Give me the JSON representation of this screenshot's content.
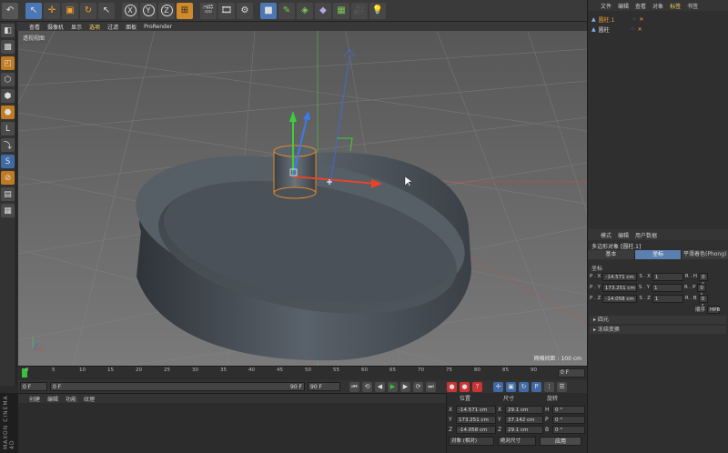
{
  "toolbar": {
    "icons": [
      "undo-icon",
      "select-icon",
      "move-icon",
      "scale-icon",
      "rotate-icon",
      "live-select-icon",
      "x-axis-icon",
      "y-axis-icon",
      "z-axis-icon",
      "world-coords-icon",
      "render-view-icon",
      "render-picture-icon",
      "render-settings-icon",
      "cube-icon",
      "pen-icon",
      "subdivision-icon",
      "deformer-icon",
      "environment-icon",
      "camera-icon",
      "light-icon"
    ],
    "axes": [
      "X",
      "Y",
      "Z"
    ]
  },
  "viewport": {
    "menu": [
      "查看",
      "摄像机",
      "显示",
      "选项",
      "过滤",
      "面板",
      "ProRender"
    ],
    "active_menu": "选项",
    "label": "透视视图",
    "grid_scale": "网格间距 : 100 cm"
  },
  "timeline": {
    "ticks": [
      "0",
      "5",
      "10",
      "15",
      "20",
      "25",
      "30",
      "35",
      "40",
      "45",
      "50",
      "55",
      "60",
      "65",
      "70",
      "75",
      "80",
      "85",
      "90"
    ],
    "frame_end": "0 F"
  },
  "playback": {
    "current": "0 F",
    "min": "0 F",
    "max": "90 F",
    "end": "90 F"
  },
  "material_manager": {
    "menu": [
      "创建",
      "编辑",
      "功能",
      "纹理"
    ]
  },
  "branding": "MAXON CINEMA 4D",
  "coordinates": {
    "headers": {
      "pos": "位置",
      "size": "尺寸",
      "rot": "旋转"
    },
    "rows": [
      {
        "axis": "X",
        "pos": "-14.571 cm",
        "size": "29.1 cm",
        "rot_axis": "H",
        "rot": "0 °"
      },
      {
        "axis": "Y",
        "pos": "173.251 cm",
        "size": "37.142 cm",
        "rot_axis": "P",
        "rot": "0 °"
      },
      {
        "axis": "Z",
        "pos": "-14.058 cm",
        "size": "29.1 cm",
        "rot_axis": "B",
        "rot": "0 °"
      }
    ],
    "mode_dropdown": "对象 (相对)",
    "size_dropdown": "绝对尺寸",
    "apply": "应用"
  },
  "object_manager": {
    "menu": [
      "文件",
      "编辑",
      "查看",
      "对象",
      "标签",
      "书签"
    ],
    "active_menu": "标签",
    "objects": [
      {
        "name": "圆柱.1",
        "selected": true
      },
      {
        "name": "圆柱",
        "selected": false
      }
    ]
  },
  "attributes": {
    "menu": [
      "模式",
      "编辑",
      "用户数据"
    ],
    "title": "多边形对象 [圆柱.1]",
    "tabs": [
      "基本",
      "坐标",
      "平滑着色(Phong)"
    ],
    "active_tab": "坐标",
    "section": "坐标",
    "rows": [
      {
        "p_label": "P . X",
        "p_val": "-14.571 cm",
        "s_label": "S . X",
        "s_val": "1",
        "r_label": "R . H",
        "r_val": "0 °"
      },
      {
        "p_label": "P . Y",
        "p_val": "173.251 cm",
        "s_label": "S . Y",
        "s_val": "1",
        "r_label": "R . P",
        "r_val": "0 °"
      },
      {
        "p_label": "P . Z",
        "p_val": "-14.058 cm",
        "s_label": "S . Z",
        "s_val": "1",
        "r_label": "R . B",
        "r_val": "0 °"
      }
    ],
    "order_label": "顺序",
    "order_value": "HPB",
    "collapsed": [
      "四元",
      "冻结变换"
    ]
  }
}
